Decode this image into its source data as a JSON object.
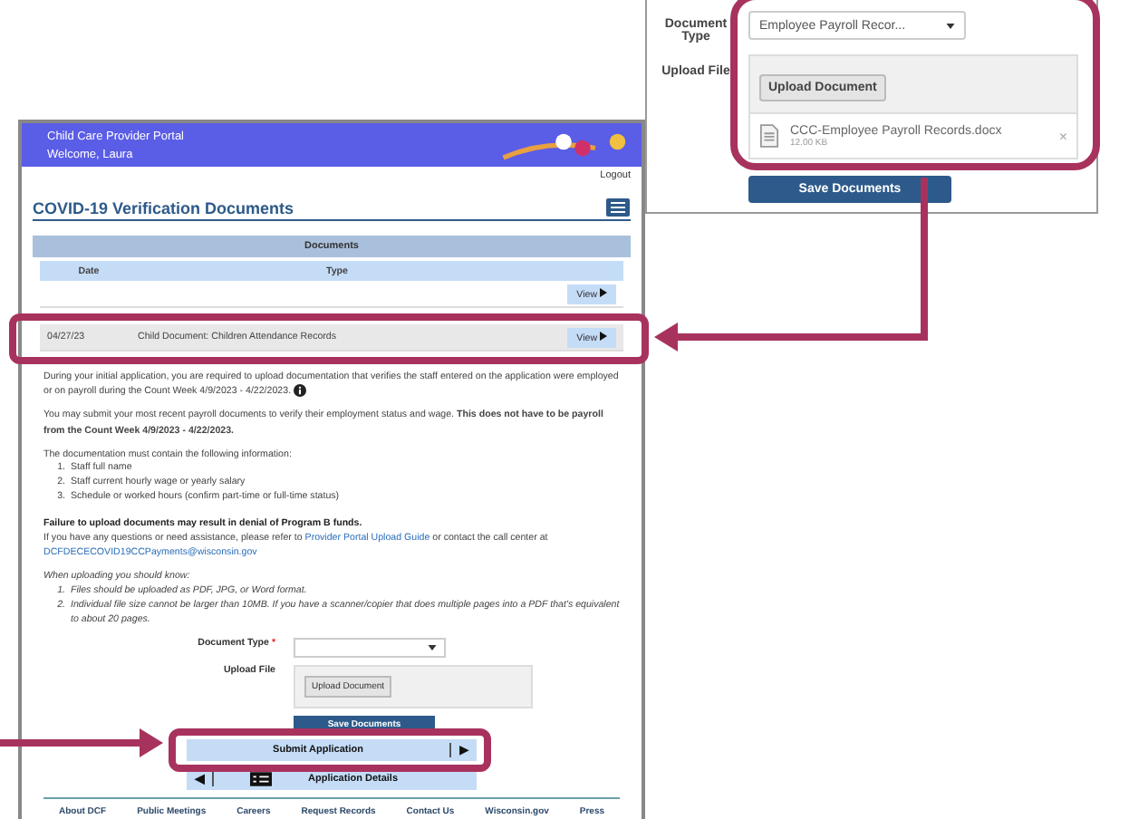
{
  "inset": {
    "document_type_label": "Document Type",
    "upload_file_label": "Upload File",
    "select_value": "Employee Payroll Recor...",
    "upload_button": "Upload Document",
    "file": {
      "name": "CCC-Employee Payroll Records.docx",
      "size": "12.00 KB",
      "remove": "×"
    },
    "save_button": "Save Documents"
  },
  "portal": {
    "title": "Child Care Provider Portal",
    "welcome": "Welcome, Laura",
    "logout": "Logout",
    "page_title": "COVID-19 Verification Documents"
  },
  "documents": {
    "heading": "Documents",
    "columns": [
      "Date",
      "Type"
    ],
    "rows": [
      {
        "date": "",
        "type": "",
        "button": "View",
        "highlighted": false
      },
      {
        "date": "04/27/23",
        "type": "Child Document: Children Attendance Records",
        "button": "View",
        "highlighted": true
      }
    ]
  },
  "paragraphs": [
    {
      "kind": "info",
      "text": "During your initial application, you are required to upload documentation that verifies the staff entered on the application were employed or on payroll during the Count Week 4/9/2023 - 4/22/2023."
    },
    {
      "kind": "plain",
      "text": "You may submit your most recent payroll documents to verify their employment status and wage. **This does not have to be payroll from the Count Week 4/9/2023 - 4/22/2023.**"
    },
    {
      "kind": "plain",
      "text": "The documentation must contain the following information:",
      "items": [
        {
          "number": "1.",
          "text": "Staff full name"
        },
        {
          "number": "2.",
          "text": "Staff current hourly wage or yearly salary"
        },
        {
          "number": "3.",
          "text": "Schedule or worked hours (confirm part-time or full-time status)"
        }
      ]
    },
    {
      "kind": "warning",
      "text": "Failure to upload documents may result in denial of Program B funds."
    },
    {
      "kind": "links",
      "text": "If you have any questions or need assistance, please refer to",
      "link": "Provider Portal Upload Guide",
      "text_after": "or contact the call center at",
      "email": "DCFDECECOVID19CCPayments@wisconsin.gov"
    },
    {
      "kind": "note",
      "text": "When uploading you should know:",
      "items": [
        {
          "number": "1.",
          "text": "Files should be uploaded as PDF, JPG, or Word format."
        },
        {
          "number": "2.",
          "text": "Individual file size cannot be larger than 10MB. If you have a scanner/copier that does multiple pages into a PDF that's equivalent to about 20 pages."
        }
      ]
    }
  ],
  "form": {
    "document_type_label": "Document Type",
    "required_mark": "*",
    "upload_file_label": "Upload File",
    "upload_button": "Upload Document",
    "save_button": "Save Documents"
  },
  "submit_button": {
    "label": "Submit Application",
    "arrow": "▶"
  },
  "details_button": {
    "label": "Application Details",
    "arrow": "◀"
  },
  "footer_links": [
    "About DCF",
    "Public Meetings",
    "Careers",
    "Request Records",
    "Contact Us",
    "Wisconsin.gov",
    "Press"
  ]
}
